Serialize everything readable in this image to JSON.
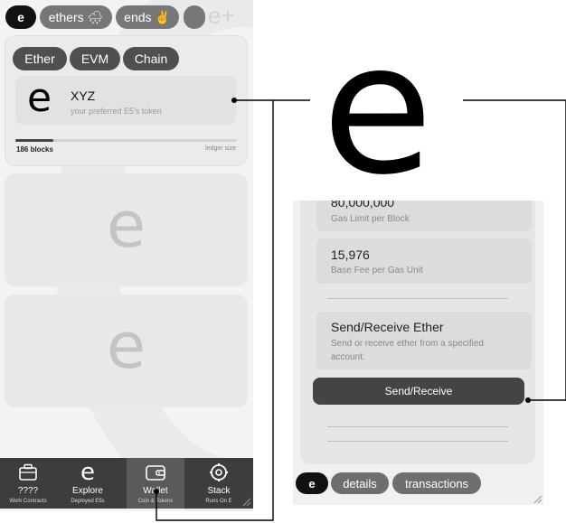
{
  "top_pills": {
    "e_label": "e",
    "ethers_label": "ethers 🌧",
    "ends_label": "ends ✌",
    "add_label": "e+"
  },
  "token_card": {
    "tabs": [
      "Ether",
      "EVM",
      "Chain"
    ],
    "logo": "e",
    "name": "XYZ",
    "description": "your preferred E5's token",
    "ledger_count": "186 blocks",
    "ledger_label": "ledger size",
    "ledger_progress": 0.17
  },
  "ghost_cards": [
    {
      "logo": "e"
    },
    {
      "logo": "e"
    }
  ],
  "bottom_nav": {
    "items": [
      {
        "title": "????",
        "sub": "Work Contracts"
      },
      {
        "title": "Explore",
        "sub": "Deployed E5s"
      },
      {
        "title": "Wallet",
        "sub": "Coin & Tokens"
      },
      {
        "title": "Stack",
        "sub": "Runs On E"
      }
    ],
    "active_index": 2
  },
  "zoom": {
    "big_logo": "e",
    "gas_limit_value": "80,000,000",
    "gas_limit_label": "Gas Limit per Block",
    "base_fee_value": "15,976",
    "base_fee_label": "Base Fee per Gas Unit",
    "send_title": "Send/Receive Ether",
    "send_description": "Send or receive ether from a specified account.",
    "send_button": "Send/Receive",
    "bottom_pills": [
      "e",
      "details",
      "transactions"
    ]
  },
  "colors": {
    "nav_bg": "#3d3d3d",
    "pill_dark": "#111111",
    "pill_grey": "#777777",
    "button_dark": "#444444"
  }
}
